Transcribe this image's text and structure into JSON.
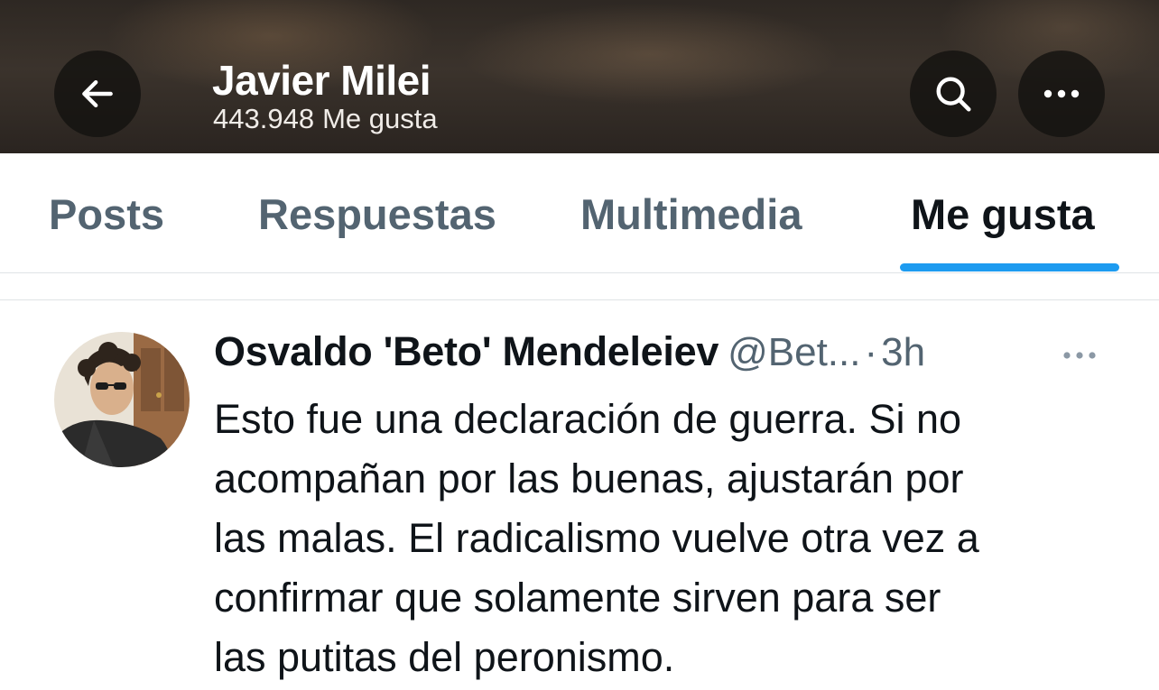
{
  "header": {
    "name": "Javier Milei",
    "likes_count": "443.948",
    "likes_label": "Me gusta",
    "icons": {
      "back": "back-arrow-icon",
      "search": "search-icon",
      "more": "more-horizontal-icon"
    }
  },
  "tabs": [
    {
      "label": "Posts",
      "active": false
    },
    {
      "label": "Respuestas",
      "active": false
    },
    {
      "label": "Multimedia",
      "active": false
    },
    {
      "label": "Me gusta",
      "active": true
    }
  ],
  "post": {
    "author_name": "Osvaldo 'Beto' Mendeleiev",
    "author_handle": "@Bet...",
    "separator": "·",
    "time": "3h",
    "text_lines": [
      "Esto fue una declaración de guerra. Si no",
      "acompañan por las buenas, ajustarán por",
      "las malas. El radicalismo vuelve otra vez a",
      "confirmar que solamente sirven para ser",
      "las putitas del peronismo."
    ]
  },
  "colors": {
    "accent": "#1d9bf0",
    "text_primary": "#0f1419",
    "text_secondary": "#536471"
  }
}
